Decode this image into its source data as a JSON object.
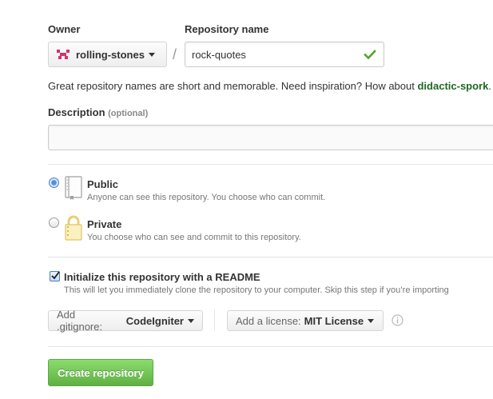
{
  "owner": {
    "label": "Owner",
    "selected": "rolling-stones",
    "avatar_color": "#d6336c"
  },
  "separator": "/",
  "repo_name": {
    "label": "Repository name",
    "value": "rock-quotes",
    "valid_color": "#55a532"
  },
  "hint": {
    "text": "Great repository names are short and memorable. Need inspiration? How about",
    "suggestion": "didactic-spork",
    "end": "."
  },
  "description": {
    "label": "Description",
    "optional": "(optional)",
    "value": ""
  },
  "visibility": {
    "public_title": "Public",
    "public_desc": "Anyone can see this repository. You choose who can commit.",
    "private_title": "Private",
    "private_desc": "You choose who can see and commit to this repository.",
    "selected": "public"
  },
  "readme": {
    "checked": true,
    "title": "Initialize this repository with a README",
    "desc": "This will let you immediately clone the repository to your computer. Skip this step if you’re importing"
  },
  "gitignore": {
    "prefix": "Add .gitignore:",
    "value": "CodeIgniter"
  },
  "license": {
    "prefix": "Add a license:",
    "value": "MIT License"
  },
  "create_button": "Create repository",
  "colors": {
    "suggestion": "#1e6823",
    "create_btn": "#60b044"
  }
}
